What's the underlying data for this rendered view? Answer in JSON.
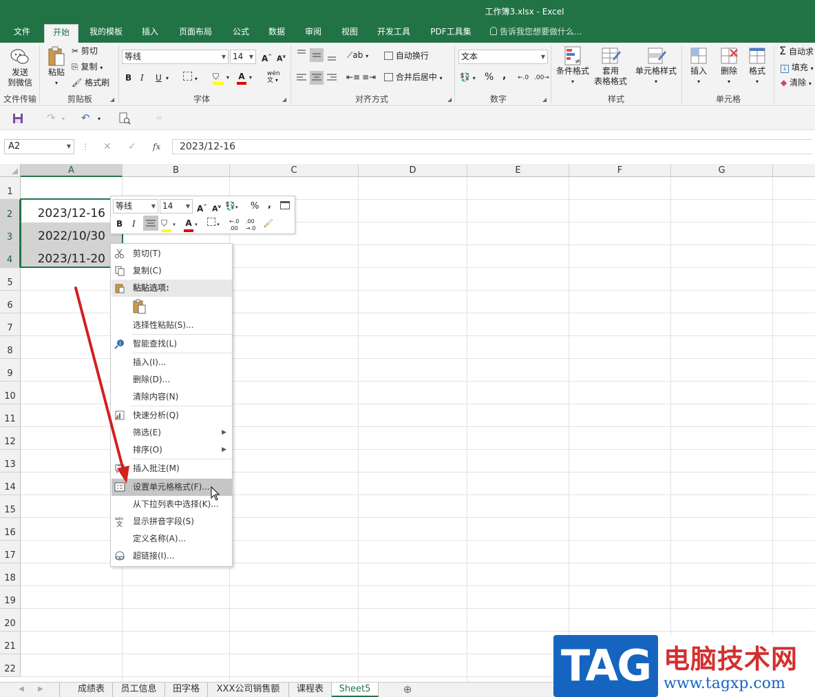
{
  "window": {
    "title": "工作簿3.xlsx - Excel"
  },
  "tabs": [
    "文件",
    "开始",
    "我的模板",
    "插入",
    "页面布局",
    "公式",
    "数据",
    "审阅",
    "视图",
    "开发工具",
    "PDF工具集"
  ],
  "active_tab": "开始",
  "tell_me": "告诉我您想要做什么...",
  "ribbon": {
    "send_wechat": "发送\n到微信",
    "paste": "粘贴",
    "cut": "剪切",
    "copy": "复制",
    "format_painter": "格式刷",
    "font_name": "等线",
    "font_size": "14",
    "bold": "B",
    "italic": "I",
    "underline": "U",
    "wrap_text": "自动换行",
    "merge_center": "合并后居中",
    "number_format": "文本",
    "percent": "%",
    "comma": ",",
    "cond_format": "条件格式",
    "table_format": "套用\n表格格式",
    "cell_style": "单元格样式",
    "insert": "插入",
    "delete": "删除",
    "format": "格式",
    "autosum": "自动求",
    "fill": "填充",
    "clear": "清除",
    "groups": [
      "文件传输",
      "剪贴板",
      "字体",
      "对齐方式",
      "数字",
      "样式",
      "单元格"
    ]
  },
  "formula_bar": {
    "name_box": "A2",
    "fx": "fx",
    "value": "2023/12-16"
  },
  "columns": [
    "A",
    "B",
    "C",
    "D",
    "E",
    "F",
    "G"
  ],
  "rows": [
    "1",
    "2",
    "3",
    "4",
    "5",
    "6",
    "7",
    "8",
    "9",
    "10",
    "11",
    "12",
    "13",
    "14",
    "15",
    "16",
    "17",
    "18",
    "19",
    "20",
    "21",
    "22"
  ],
  "cells": {
    "A2": "2023/12-16",
    "A3": "2022/10/30",
    "A4": "2023/11-20"
  },
  "mini_toolbar": {
    "font": "等线",
    "size": "14",
    "bold": "B",
    "italic": "I",
    "percent": "%",
    "comma": ","
  },
  "context_menu": [
    {
      "label": "剪切(T)",
      "icon": "scissors-icon"
    },
    {
      "label": "复制(C)",
      "icon": "copy-icon"
    },
    {
      "label": "粘贴选项:",
      "icon": "paste-icon",
      "header": true
    },
    {
      "label": "",
      "icon": "paste-clipboard-icon"
    },
    {
      "label": "选择性粘贴(S)...",
      "icon": ""
    },
    {
      "label": "智能查找(L)",
      "icon": "smart-lookup-icon"
    },
    {
      "label": "插入(I)...",
      "icon": ""
    },
    {
      "label": "删除(D)...",
      "icon": ""
    },
    {
      "label": "清除内容(N)",
      "icon": ""
    },
    {
      "label": "快速分析(Q)",
      "icon": "quick-analysis-icon"
    },
    {
      "label": "筛选(E)",
      "icon": "",
      "submenu": true
    },
    {
      "label": "排序(O)",
      "icon": "",
      "submenu": true
    },
    {
      "label": "插入批注(M)",
      "icon": "comment-icon"
    },
    {
      "label": "设置单元格格式(F)...",
      "icon": "format-cells-icon",
      "highlighted": true
    },
    {
      "label": "从下拉列表中选择(K)...",
      "icon": ""
    },
    {
      "label": "显示拼音字段(S)",
      "icon": "phonetic-icon"
    },
    {
      "label": "定义名称(A)...",
      "icon": ""
    },
    {
      "label": "超链接(I)...",
      "icon": "hyperlink-icon"
    }
  ],
  "sheets": [
    "成绩表",
    "员工信息",
    "田字格",
    "XXX公司销售额",
    "课程表",
    "Sheet5"
  ],
  "active_sheet": "Sheet5",
  "watermark": {
    "logo": "TAG",
    "text": "电脑技术网",
    "url": "www.tagxp.com"
  },
  "colors": {
    "excel_green": "#217346",
    "arrow_red": "#d32020"
  }
}
